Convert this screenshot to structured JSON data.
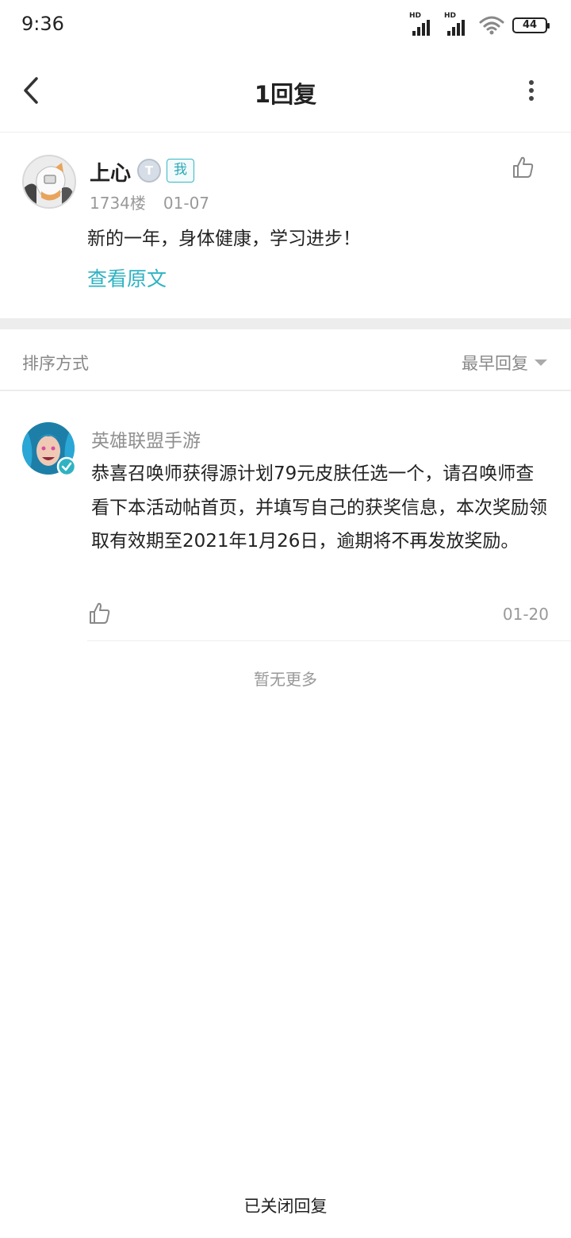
{
  "status_bar": {
    "time": "9:36",
    "hd1": "HD",
    "hd2": "HD",
    "battery": "44"
  },
  "header": {
    "title": "1回复"
  },
  "post": {
    "author": "上心",
    "level_badge": "T",
    "me_badge": "我",
    "floor": "1734楼",
    "date": "01-07",
    "content": "新的一年，身体健康，学习进步！",
    "view_original": "查看原文"
  },
  "sort": {
    "label": "排序方式",
    "selected": "最早回复"
  },
  "reply": {
    "author": "英雄联盟手游",
    "content": "恭喜召唤师获得源计划79元皮肤任选一个，请召唤师查看下本活动帖首页，并填写自己的获奖信息，本次奖励领取有效期至2021年1月26日，逾期将不再发放奖励。",
    "date": "01-20"
  },
  "footer": {
    "no_more": "暂无更多",
    "closed": "已关闭回复"
  },
  "colors": {
    "accent": "#2fb3c2",
    "muted": "#999999",
    "divider": "#ededed"
  }
}
